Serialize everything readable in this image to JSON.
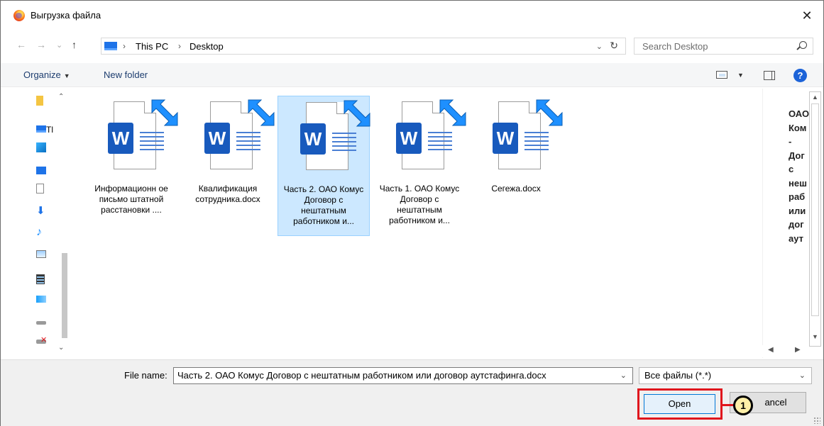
{
  "window": {
    "title": "Выгрузка файла",
    "close_glyph": "✕",
    "app_icon": "firefox-icon"
  },
  "navigation": {
    "back_glyph": "←",
    "forward_glyph": "→",
    "recent_glyph": "⌄",
    "up_glyph": "↑",
    "breadcrumb": [
      "This PC",
      "Desktop"
    ],
    "breadcrumb_sep": "›",
    "dropdown_glyph": "⌄",
    "refresh_glyph": "↻"
  },
  "search": {
    "placeholder": "Search Desktop"
  },
  "toolbar": {
    "organize_label": "Organize",
    "caret": "▼",
    "new_folder_label": "New folder",
    "help_glyph": "?"
  },
  "left_nav": {
    "partial_label": "Tl"
  },
  "files": [
    {
      "name": "Информационн ое письмо штатной расстановки ....",
      "type": "word-doc",
      "shortcut": true,
      "selected": false
    },
    {
      "name": "Квалификация сотрудника.docx",
      "type": "word-doc",
      "shortcut": true,
      "selected": false
    },
    {
      "name": "Часть 2. ОАО Комус Договор с нештатным работником и...",
      "type": "word-doc",
      "shortcut": true,
      "selected": true
    },
    {
      "name": "Часть 1. ОАО Комус Договор с нештатным работником и...",
      "type": "word-doc",
      "shortcut": true,
      "selected": false
    },
    {
      "name": "Сегежа.docx",
      "type": "word-doc",
      "shortcut": true,
      "selected": false
    }
  ],
  "word_badge_letter": "W",
  "preview": {
    "text": "ОАО\nКом\n-\nДог\nс\nнеш\nраб\nили\nдог\nаут"
  },
  "bottom": {
    "file_name_label": "File name:",
    "file_name_value": "Часть 2. ОАО Комус Договор с нештатным работником или договор аутстафинга.docx",
    "file_type_value": "Все файлы (*.*)",
    "open_label": "Open",
    "cancel_label": "ancel",
    "callout_number": "1",
    "highlight_color": "#e0161d"
  }
}
